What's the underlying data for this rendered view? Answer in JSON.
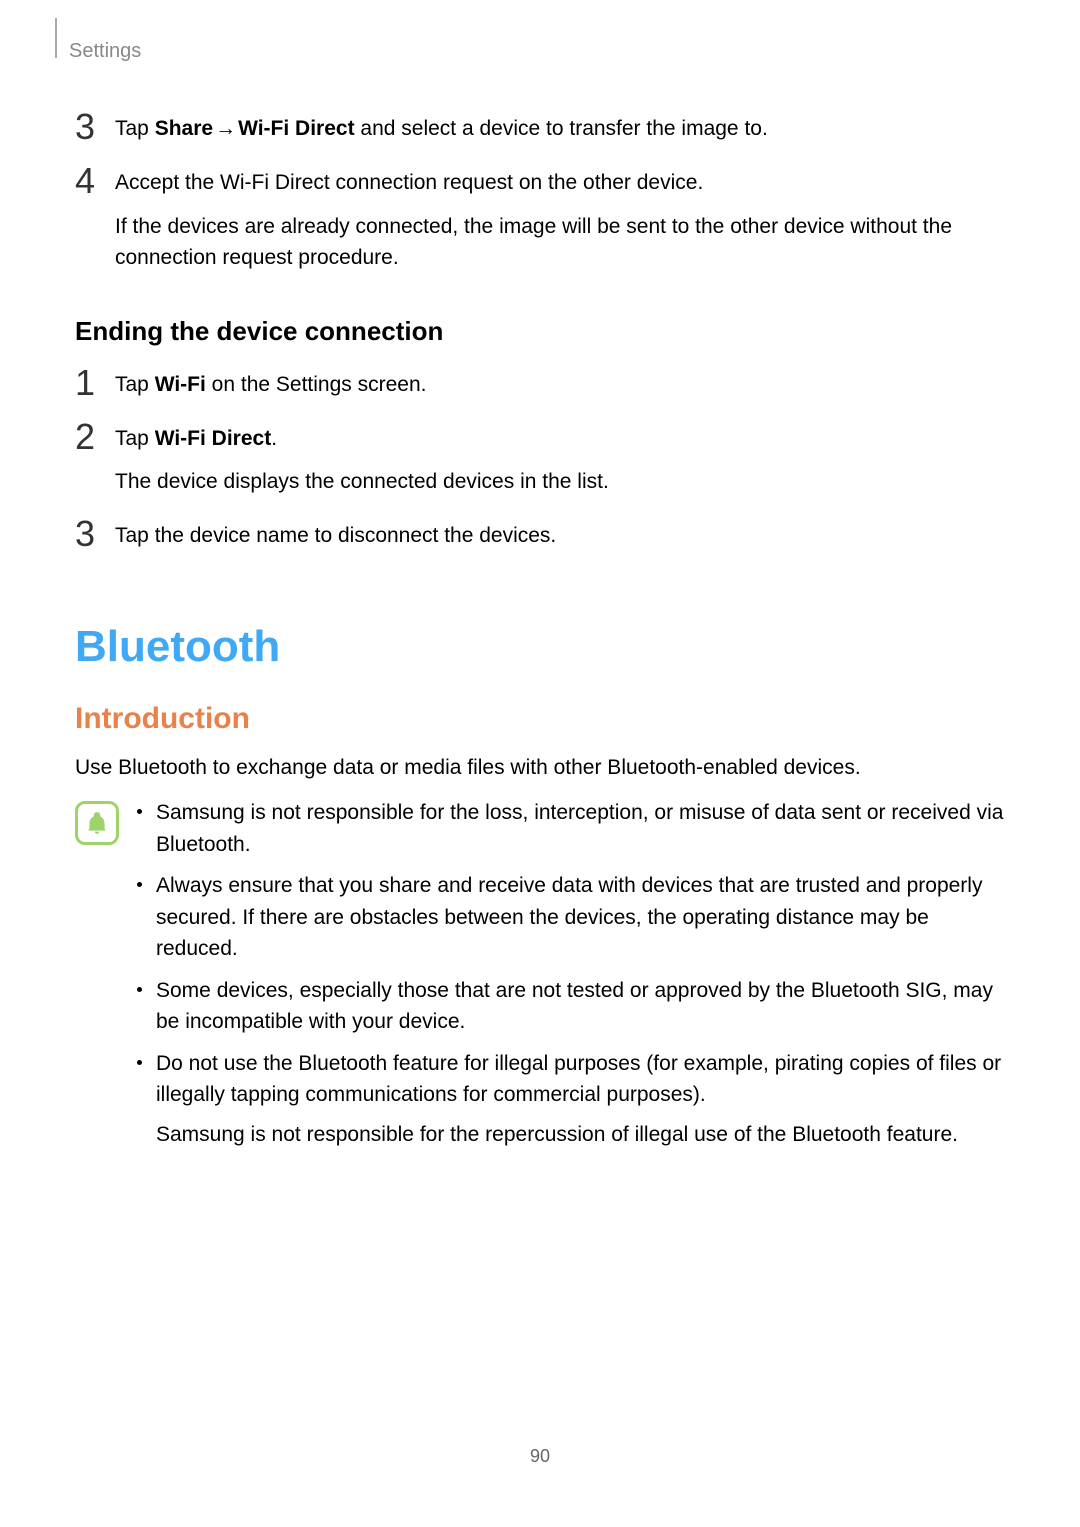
{
  "header": {
    "section_label": "Settings"
  },
  "top_steps": {
    "step3": {
      "number": "3",
      "tap": "Tap ",
      "share": "Share",
      "arrow": " → ",
      "wifi_direct": "Wi-Fi Direct",
      "rest": " and select a device to transfer the image to."
    },
    "step4": {
      "number": "4",
      "line1": "Accept the Wi-Fi Direct connection request on the other device.",
      "line2": "If the devices are already connected, the image will be sent to the other device without the connection request procedure."
    }
  },
  "ending": {
    "heading": "Ending the device connection",
    "step1": {
      "number": "1",
      "tap": "Tap ",
      "bold": "Wi-Fi",
      "rest": " on the Settings screen."
    },
    "step2": {
      "number": "2",
      "tap": "Tap ",
      "bold": "Wi-Fi Direct",
      "period": ".",
      "line2": "The device displays the connected devices in the list."
    },
    "step3": {
      "number": "3",
      "text": "Tap the device name to disconnect the devices."
    }
  },
  "bluetooth": {
    "heading": "Bluetooth",
    "intro_heading": "Introduction",
    "intro_text": "Use Bluetooth to exchange data or media files with other Bluetooth-enabled devices.",
    "notices": {
      "n1": "Samsung is not responsible for the loss, interception, or misuse of data sent or received via Bluetooth.",
      "n2": "Always ensure that you share and receive data with devices that are trusted and properly secured. If there are obstacles between the devices, the operating distance may be reduced.",
      "n3": "Some devices, especially those that are not tested or approved by the Bluetooth SIG, may be incompatible with your device.",
      "n4a": "Do not use the Bluetooth feature for illegal purposes (for example, pirating copies of files or illegally tapping communications for commercial purposes).",
      "n4b": "Samsung is not responsible for the repercussion of illegal use of the Bluetooth feature."
    }
  },
  "page_number": "90"
}
